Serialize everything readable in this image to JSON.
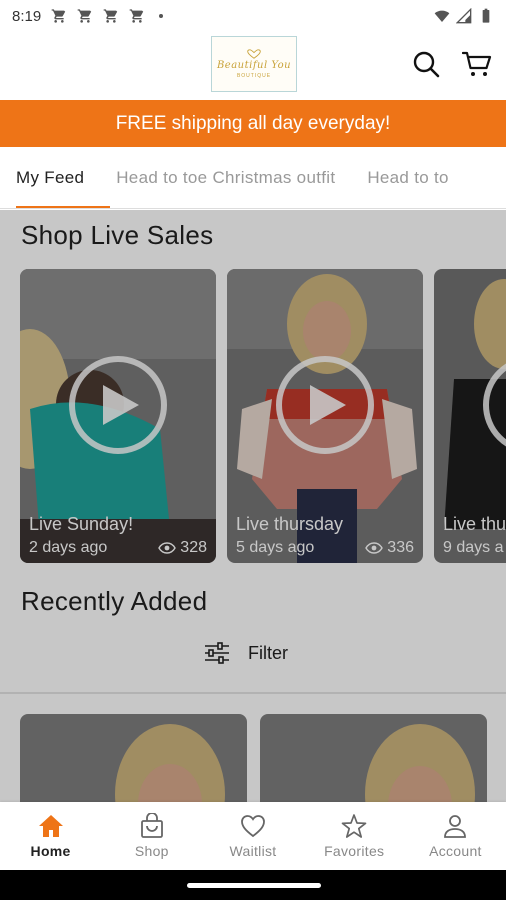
{
  "status_bar": {
    "time": "8:19",
    "notification_icons": [
      "shopping-cart-icon",
      "shopping-cart-icon",
      "shopping-cart-icon",
      "shopping-cart-icon"
    ],
    "right_icons": [
      "wifi-icon",
      "cell-signal-icon",
      "battery-icon"
    ]
  },
  "header": {
    "logo_text": "Beautiful You",
    "logo_subtext": "BOUTIQUE"
  },
  "promo": {
    "text": "FREE shipping all day everyday!"
  },
  "tabs": [
    {
      "label": "My Feed",
      "active": true
    },
    {
      "label": "Head to toe Christmas outfit",
      "active": false
    },
    {
      "label": "Head to to",
      "active": false
    }
  ],
  "live_sales": {
    "title": "Shop Live Sales",
    "items": [
      {
        "title": "Live Sunday!",
        "time": "2 days ago",
        "views": "328"
      },
      {
        "title": "Live thursday",
        "time": "5 days ago",
        "views": "336"
      },
      {
        "title": "Live thu",
        "time": "9 days a",
        "views": ""
      }
    ]
  },
  "recently_added": {
    "title": "Recently Added",
    "filter_label": "Filter"
  },
  "bottom_nav": [
    {
      "label": "Home",
      "icon": "home-icon",
      "active": true
    },
    {
      "label": "Shop",
      "icon": "shopping-bag-icon",
      "active": false
    },
    {
      "label": "Waitlist",
      "icon": "heart-icon",
      "active": false
    },
    {
      "label": "Favorites",
      "icon": "star-icon",
      "active": false
    },
    {
      "label": "Account",
      "icon": "account-icon",
      "active": false
    }
  ],
  "colors": {
    "accent": "#ee7417",
    "logo_gold": "#c9a33a"
  }
}
